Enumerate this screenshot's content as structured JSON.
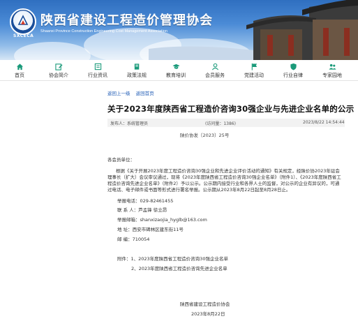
{
  "header": {
    "org_name": "陕西省建设工程造价管理协会",
    "org_name_en": "Shaanxi Province Construction Engineering Cost Management Association",
    "logo_text": "SXCECA"
  },
  "nav": [
    {
      "label": "首页",
      "icon": "home-icon"
    },
    {
      "label": "协会简介",
      "icon": "edit-icon"
    },
    {
      "label": "行业资讯",
      "icon": "news-icon"
    },
    {
      "label": "政策法规",
      "icon": "book-icon"
    },
    {
      "label": "教育培训",
      "icon": "graduation-cap-icon"
    },
    {
      "label": "会员服务",
      "icon": "user-icon"
    },
    {
      "label": "党建活动",
      "icon": "flag-icon"
    },
    {
      "label": "行业自律",
      "icon": "shield-icon"
    },
    {
      "label": "专家园地",
      "icon": "group-icon"
    }
  ],
  "breadcrumb": {
    "prev": "返回上一级",
    "home": "返回首页"
  },
  "article": {
    "title": "关于2023年度陕西省工程造价咨询30强企业与先进企业名单的公示",
    "publisher": "发布人：系统管理员",
    "views": "(访问量：1386)",
    "datetime": "2023/8/22 14:54:44",
    "doc_number": "陕价协发〔2023〕25号",
    "salutation": "各会员单位：",
    "paragraph": "根据《关于开展2023年度工程造价咨询30强企业和先进企业评价活动的通知》有关规定，经陕价协2023年驻会理事长（扩大）会议审议通过，现将《2023年度陕西省工程造价咨询30强企业名单》（附件1）、《2023年度陕西省工程造价咨询先进企业名单》（附件2）予以公示。公示期内接受行业和各界人士的监督，对公示的企业有异议的，可通过电话、电子邮件或书面等形式进行署名举报。公示期从2023年8月22日起至8月28日止。",
    "contacts": [
      "举报电话：029-82461455",
      "联 系 人：芦孟锋  徐立昂",
      "举报邮箱：shanxizaojia_hyglb@163.com",
      "地    址：西安市碑林区建东街11号",
      "邮    编：710054"
    ],
    "attachments": [
      "附件：1、2023年度陕西省工程造价咨询30强企业名单",
      "2、2023年度陕西省工程造价咨询先进企业名单"
    ],
    "signature": "陕西省建设工程造价协会",
    "sign_date": "2023年8月22日"
  },
  "colors": {
    "nav_icon": "#1a9a7a",
    "link": "#1f5bb5",
    "banner_blue": "#2f6fc0"
  }
}
